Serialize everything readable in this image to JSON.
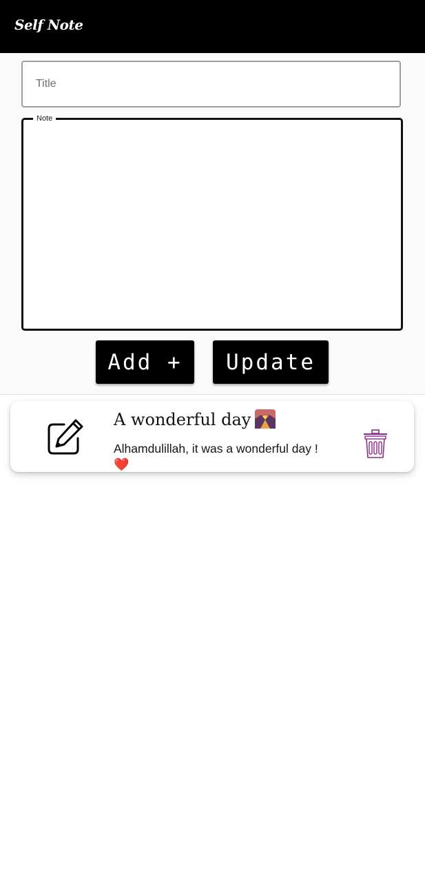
{
  "app": {
    "title": "Self Note"
  },
  "form": {
    "title_placeholder": "Title",
    "title_value": "",
    "note_label": "Note",
    "note_value": "",
    "add_label": "Add +",
    "update_label": "Update"
  },
  "notes": [
    {
      "title": "A wonderful day",
      "title_emoji": "sunrise-over-mountains",
      "body": "Alhamdulillah, it was a wonderful day !",
      "body_emoji": "❤️",
      "edit_icon": "edit-pencil-icon",
      "delete_icon": "trash-icon"
    }
  ],
  "colors": {
    "appbar": "#000000",
    "button_bg": "#000000",
    "button_text": "#ffffff",
    "trash_icon": "#8e2c8e",
    "heart": "#e84b4b"
  }
}
